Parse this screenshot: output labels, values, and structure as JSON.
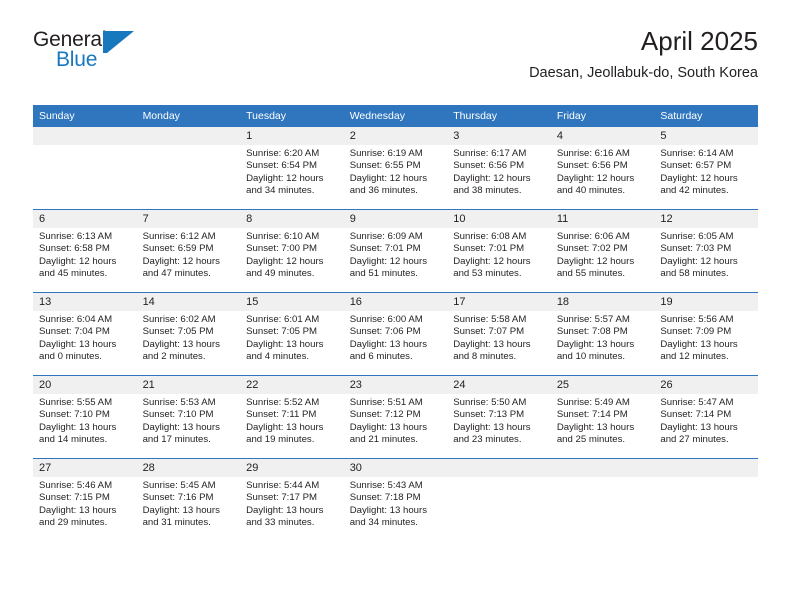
{
  "brand": {
    "name_part1": "General",
    "name_part2": "Blue",
    "logo_icon": "triangle-flag-icon",
    "accent_color": "#1878be"
  },
  "header": {
    "title": "April 2025",
    "subtitle": "Daesan, Jeollabuk-do, South Korea"
  },
  "colors": {
    "header_blue": "#2f76be",
    "daynum_band": "#f0f0f0",
    "text": "#231f20"
  },
  "calendar": {
    "weekdays": [
      "Sunday",
      "Monday",
      "Tuesday",
      "Wednesday",
      "Thursday",
      "Friday",
      "Saturday"
    ],
    "weeks": [
      [
        {
          "day": ""
        },
        {
          "day": ""
        },
        {
          "day": "1",
          "sunrise": "Sunrise: 6:20 AM",
          "sunset": "Sunset: 6:54 PM",
          "daylight": "Daylight: 12 hours and 34 minutes."
        },
        {
          "day": "2",
          "sunrise": "Sunrise: 6:19 AM",
          "sunset": "Sunset: 6:55 PM",
          "daylight": "Daylight: 12 hours and 36 minutes."
        },
        {
          "day": "3",
          "sunrise": "Sunrise: 6:17 AM",
          "sunset": "Sunset: 6:56 PM",
          "daylight": "Daylight: 12 hours and 38 minutes."
        },
        {
          "day": "4",
          "sunrise": "Sunrise: 6:16 AM",
          "sunset": "Sunset: 6:56 PM",
          "daylight": "Daylight: 12 hours and 40 minutes."
        },
        {
          "day": "5",
          "sunrise": "Sunrise: 6:14 AM",
          "sunset": "Sunset: 6:57 PM",
          "daylight": "Daylight: 12 hours and 42 minutes."
        }
      ],
      [
        {
          "day": "6",
          "sunrise": "Sunrise: 6:13 AM",
          "sunset": "Sunset: 6:58 PM",
          "daylight": "Daylight: 12 hours and 45 minutes."
        },
        {
          "day": "7",
          "sunrise": "Sunrise: 6:12 AM",
          "sunset": "Sunset: 6:59 PM",
          "daylight": "Daylight: 12 hours and 47 minutes."
        },
        {
          "day": "8",
          "sunrise": "Sunrise: 6:10 AM",
          "sunset": "Sunset: 7:00 PM",
          "daylight": "Daylight: 12 hours and 49 minutes."
        },
        {
          "day": "9",
          "sunrise": "Sunrise: 6:09 AM",
          "sunset": "Sunset: 7:01 PM",
          "daylight": "Daylight: 12 hours and 51 minutes."
        },
        {
          "day": "10",
          "sunrise": "Sunrise: 6:08 AM",
          "sunset": "Sunset: 7:01 PM",
          "daylight": "Daylight: 12 hours and 53 minutes."
        },
        {
          "day": "11",
          "sunrise": "Sunrise: 6:06 AM",
          "sunset": "Sunset: 7:02 PM",
          "daylight": "Daylight: 12 hours and 55 minutes."
        },
        {
          "day": "12",
          "sunrise": "Sunrise: 6:05 AM",
          "sunset": "Sunset: 7:03 PM",
          "daylight": "Daylight: 12 hours and 58 minutes."
        }
      ],
      [
        {
          "day": "13",
          "sunrise": "Sunrise: 6:04 AM",
          "sunset": "Sunset: 7:04 PM",
          "daylight": "Daylight: 13 hours and 0 minutes."
        },
        {
          "day": "14",
          "sunrise": "Sunrise: 6:02 AM",
          "sunset": "Sunset: 7:05 PM",
          "daylight": "Daylight: 13 hours and 2 minutes."
        },
        {
          "day": "15",
          "sunrise": "Sunrise: 6:01 AM",
          "sunset": "Sunset: 7:05 PM",
          "daylight": "Daylight: 13 hours and 4 minutes."
        },
        {
          "day": "16",
          "sunrise": "Sunrise: 6:00 AM",
          "sunset": "Sunset: 7:06 PM",
          "daylight": "Daylight: 13 hours and 6 minutes."
        },
        {
          "day": "17",
          "sunrise": "Sunrise: 5:58 AM",
          "sunset": "Sunset: 7:07 PM",
          "daylight": "Daylight: 13 hours and 8 minutes."
        },
        {
          "day": "18",
          "sunrise": "Sunrise: 5:57 AM",
          "sunset": "Sunset: 7:08 PM",
          "daylight": "Daylight: 13 hours and 10 minutes."
        },
        {
          "day": "19",
          "sunrise": "Sunrise: 5:56 AM",
          "sunset": "Sunset: 7:09 PM",
          "daylight": "Daylight: 13 hours and 12 minutes."
        }
      ],
      [
        {
          "day": "20",
          "sunrise": "Sunrise: 5:55 AM",
          "sunset": "Sunset: 7:10 PM",
          "daylight": "Daylight: 13 hours and 14 minutes."
        },
        {
          "day": "21",
          "sunrise": "Sunrise: 5:53 AM",
          "sunset": "Sunset: 7:10 PM",
          "daylight": "Daylight: 13 hours and 17 minutes."
        },
        {
          "day": "22",
          "sunrise": "Sunrise: 5:52 AM",
          "sunset": "Sunset: 7:11 PM",
          "daylight": "Daylight: 13 hours and 19 minutes."
        },
        {
          "day": "23",
          "sunrise": "Sunrise: 5:51 AM",
          "sunset": "Sunset: 7:12 PM",
          "daylight": "Daylight: 13 hours and 21 minutes."
        },
        {
          "day": "24",
          "sunrise": "Sunrise: 5:50 AM",
          "sunset": "Sunset: 7:13 PM",
          "daylight": "Daylight: 13 hours and 23 minutes."
        },
        {
          "day": "25",
          "sunrise": "Sunrise: 5:49 AM",
          "sunset": "Sunset: 7:14 PM",
          "daylight": "Daylight: 13 hours and 25 minutes."
        },
        {
          "day": "26",
          "sunrise": "Sunrise: 5:47 AM",
          "sunset": "Sunset: 7:14 PM",
          "daylight": "Daylight: 13 hours and 27 minutes."
        }
      ],
      [
        {
          "day": "27",
          "sunrise": "Sunrise: 5:46 AM",
          "sunset": "Sunset: 7:15 PM",
          "daylight": "Daylight: 13 hours and 29 minutes."
        },
        {
          "day": "28",
          "sunrise": "Sunrise: 5:45 AM",
          "sunset": "Sunset: 7:16 PM",
          "daylight": "Daylight: 13 hours and 31 minutes."
        },
        {
          "day": "29",
          "sunrise": "Sunrise: 5:44 AM",
          "sunset": "Sunset: 7:17 PM",
          "daylight": "Daylight: 13 hours and 33 minutes."
        },
        {
          "day": "30",
          "sunrise": "Sunrise: 5:43 AM",
          "sunset": "Sunset: 7:18 PM",
          "daylight": "Daylight: 13 hours and 34 minutes."
        },
        {
          "day": ""
        },
        {
          "day": ""
        },
        {
          "day": ""
        }
      ]
    ]
  }
}
